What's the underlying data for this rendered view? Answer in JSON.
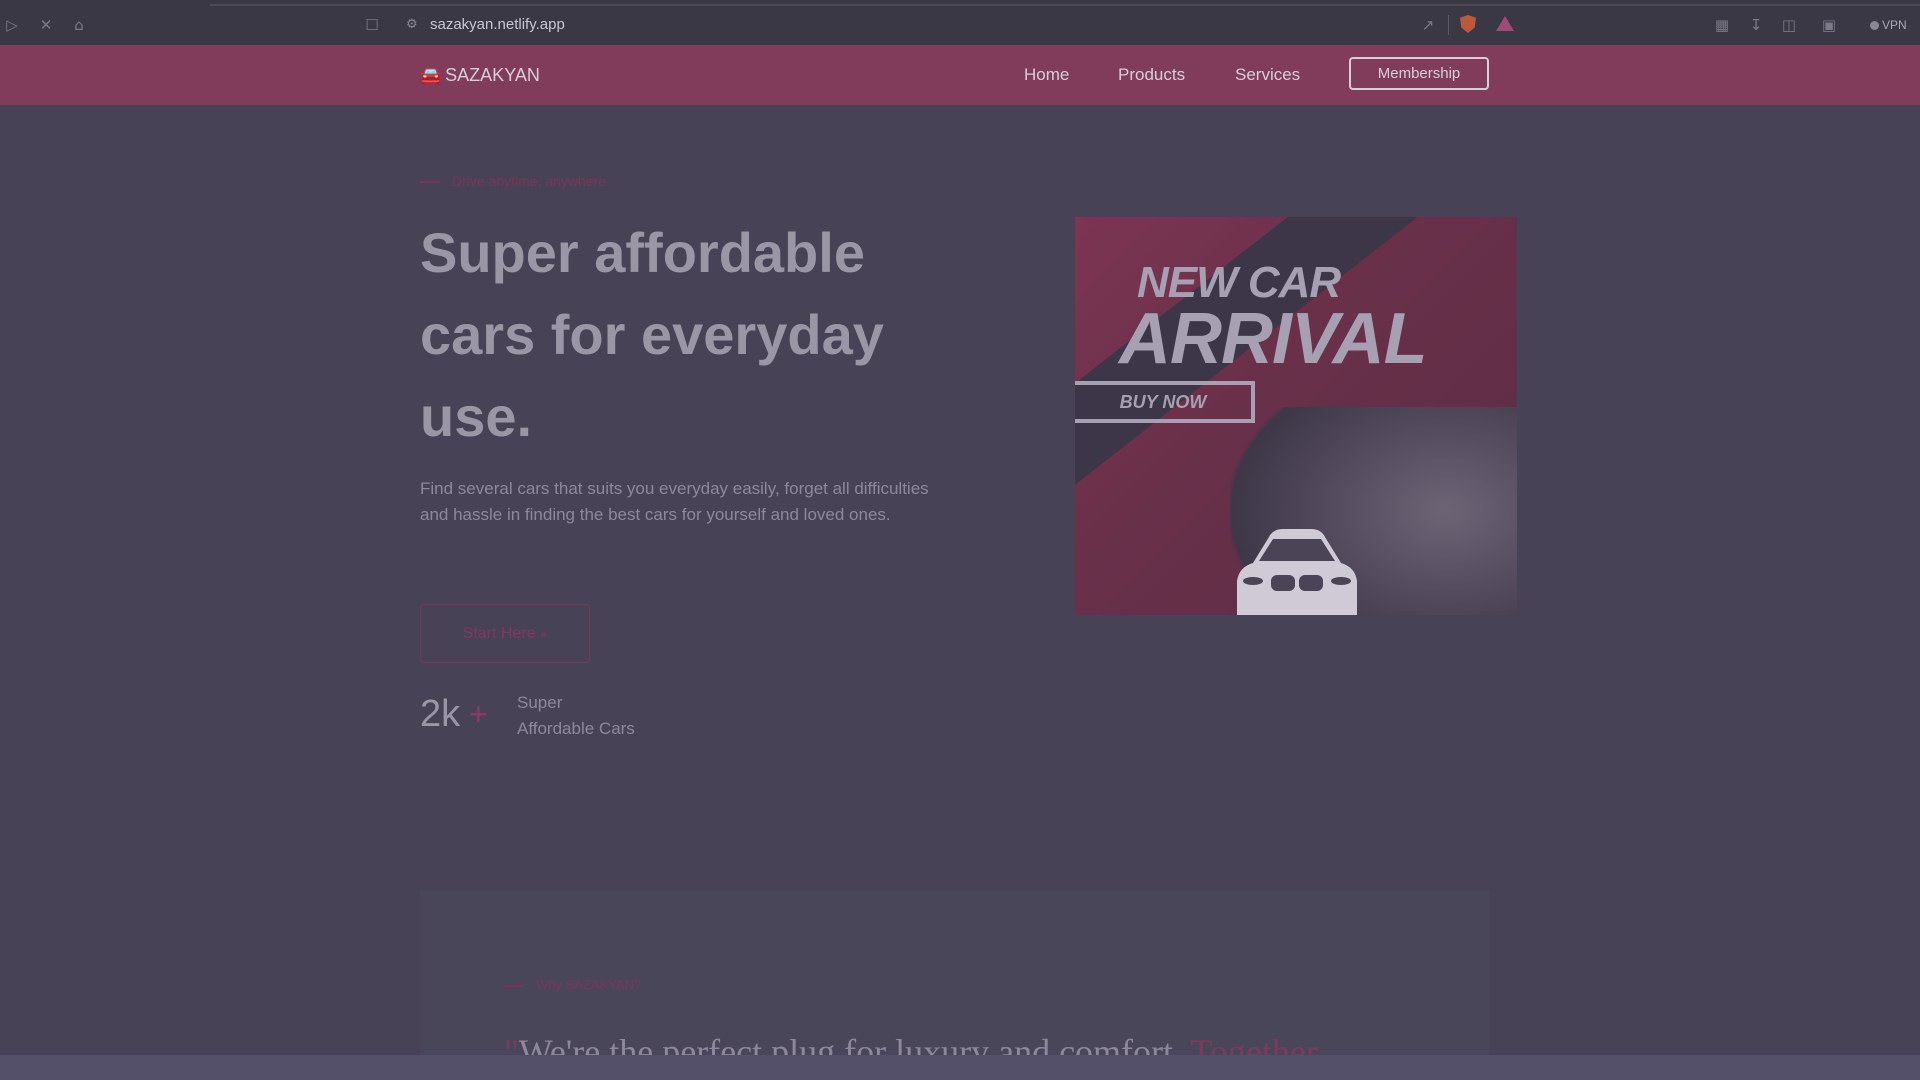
{
  "browser": {
    "url": "sazakyan.netlify.app",
    "vpn_label": "VPN",
    "icons": [
      "play-icon",
      "close-icon",
      "home-icon",
      "bookmark-icon",
      "site-settings-icon",
      "share-icon",
      "brave-shield-icon",
      "brave-rewards-icon",
      "extensions-icon",
      "download-icon",
      "sidebar-icon",
      "wallet-icon",
      "vpn-icon"
    ]
  },
  "nav": {
    "brand": "SAZAKYAN",
    "brand_icon": "car-icon",
    "links": [
      "Home",
      "Products",
      "Services"
    ],
    "cta": "Membership"
  },
  "hero": {
    "eyebrow": "Drive anytime, anywhere",
    "headline": "Super affordable cars for everyday use.",
    "description": "Find several cars that suits you everyday easily, forget all difficulties and hassle in finding the best cars for yourself and loved ones.",
    "cta": "Start Here",
    "cta_icon": "double-chevron-down-icon",
    "stat_value": "2k",
    "stat_plus": "+",
    "stat_label_line1": "Super",
    "stat_label_line2": "Affordable Cars"
  },
  "ad": {
    "line1": "NEW CAR",
    "line2": "ARRIVAL",
    "button": "BUY NOW"
  },
  "why": {
    "eyebrow": "Why SAZAKYAN?",
    "quote_open": "\"",
    "quote_text": "We're the perfect plug for luxury and comfort. ",
    "quote_highlight": "Together"
  },
  "colors": {
    "page_bg": "#484257",
    "navbar_bg": "#813c5c",
    "accent": "#7e3a5c",
    "text_muted": "#8d889a"
  }
}
